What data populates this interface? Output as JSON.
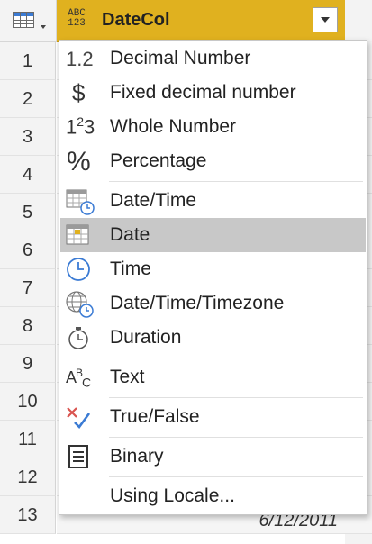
{
  "column": {
    "name": "DateCol",
    "type_icon_line1": "ABC",
    "type_icon_line2": "123"
  },
  "rows": [
    "1",
    "2",
    "3",
    "4",
    "5",
    "6",
    "7",
    "8",
    "9",
    "10",
    "11",
    "12",
    "13"
  ],
  "row13_value": "6/12/2011",
  "menu": {
    "items": [
      {
        "label": "Decimal Number",
        "icon": "decimal-number-icon"
      },
      {
        "label": "Fixed decimal number",
        "icon": "currency-icon"
      },
      {
        "label": "Whole Number",
        "icon": "whole-number-icon"
      },
      {
        "label": "Percentage",
        "icon": "percentage-icon"
      },
      {
        "label": "Date/Time",
        "icon": "date-time-icon"
      },
      {
        "label": "Date",
        "icon": "calendar-icon",
        "selected": true
      },
      {
        "label": "Time",
        "icon": "clock-icon"
      },
      {
        "label": "Date/Time/Timezone",
        "icon": "globe-clock-icon"
      },
      {
        "label": "Duration",
        "icon": "stopwatch-icon"
      },
      {
        "label": "Text",
        "icon": "text-icon"
      },
      {
        "label": "True/False",
        "icon": "true-false-icon"
      },
      {
        "label": "Binary",
        "icon": "binary-icon"
      },
      {
        "label": "Using Locale...",
        "icon": ""
      }
    ],
    "glyphs": {
      "decimal": "1.2",
      "dollar": "$",
      "whole_base": "1",
      "whole_sup": "2",
      "whole_end": "3",
      "percent": "%",
      "text_a": "A",
      "text_b": "B",
      "text_c": "C"
    }
  },
  "colors": {
    "header_accent": "#e0b11f",
    "selected_item": "#c8c8c8",
    "clock_blue": "#3b7bd4",
    "false_red": "#d9534f"
  }
}
